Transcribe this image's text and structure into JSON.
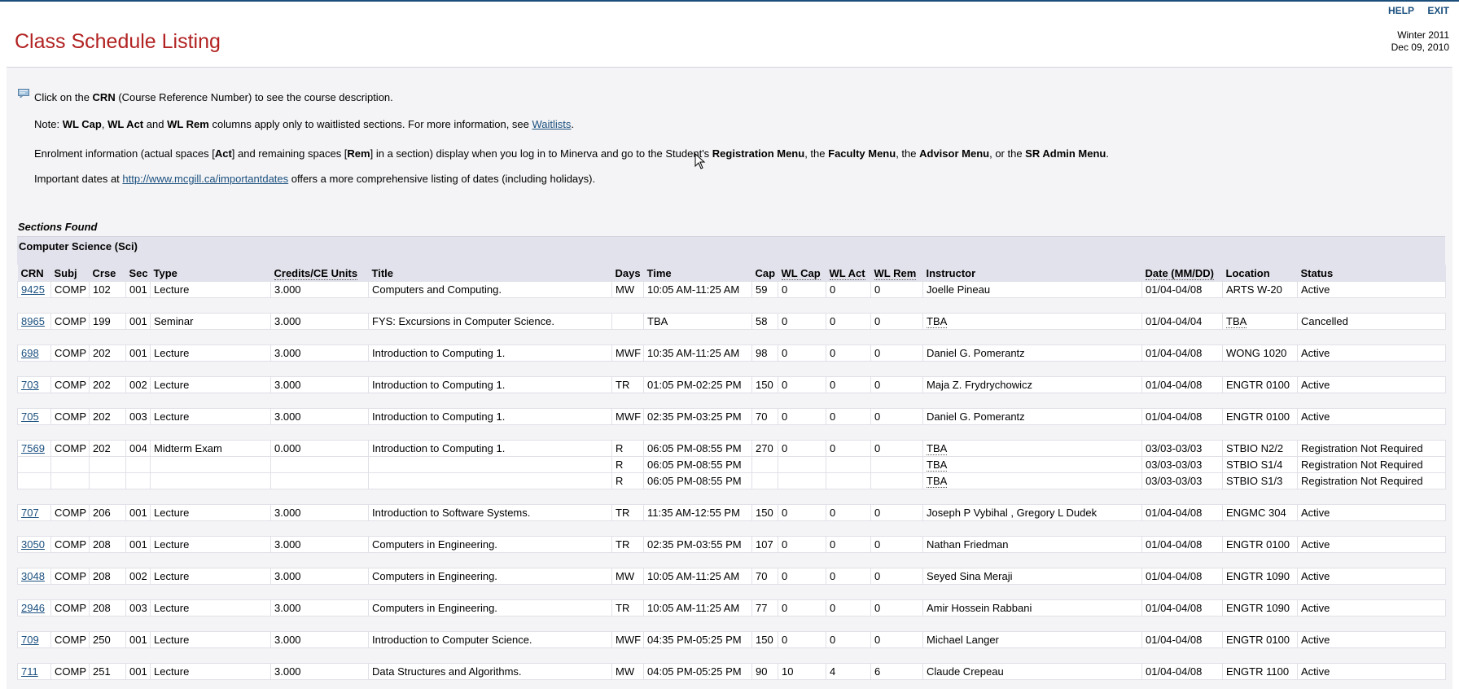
{
  "header": {
    "links": [
      "HELP",
      "EXIT"
    ],
    "title": "Class Schedule Listing",
    "term": "Winter 2011",
    "date": "Dec 09, 2010"
  },
  "notes": {
    "crn": {
      "pre": "Click on the ",
      "bold": "CRN",
      "post": " (Course Reference Number) to see the course description."
    },
    "waitlist": {
      "pre": "Note: ",
      "b1": "WL Cap",
      "m1": ", ",
      "b2": "WL Act",
      "m2": " and ",
      "b3": "WL Rem",
      "m3": " columns apply only to waitlisted sections. For more information, see ",
      "link": "Waitlists",
      "post": "."
    },
    "enrolment": {
      "t1": "Enrolment information (actual spaces [",
      "b1": "Act",
      "t2": "] and remaining spaces [",
      "b2": "Rem",
      "t3": "] in a section) display when you log in to Minerva and go to the Student's ",
      "b3": "Registration Menu",
      "t4": ", the ",
      "b4": "Faculty Menu",
      "t5": ", the ",
      "b5": "Advisor Menu",
      "t6": ", or the ",
      "b6": "SR Admin Menu",
      "t7": "."
    },
    "dates": {
      "pre": "Important dates at ",
      "link": "http://www.mcgill.ca/importantdates",
      "post": " offers a more comprehensive listing of dates (including holidays)."
    }
  },
  "sections_found": "Sections Found",
  "subject": "Computer Science (Sci)",
  "columns": [
    "CRN",
    "Subj",
    "Crse",
    "Sec",
    "Type",
    "Credits/CE Units",
    "Title",
    "Days",
    "Time",
    "Cap",
    "WL Cap",
    "WL Act",
    "WL Rem",
    "Instructor",
    "Date (MM/DD)",
    "Location",
    "Status"
  ],
  "rows": [
    {
      "crn": "9425",
      "subj": "COMP",
      "crse": "102",
      "sec": "001",
      "type": "Lecture",
      "credits": "3.000",
      "title": "Computers and Computing.",
      "days": "MW",
      "time": "10:05 AM-11:25 AM",
      "cap": "59",
      "wlcap": "0",
      "wlact": "0",
      "wlrem": "0",
      "instructor": "Joelle Pineau",
      "date": "01/04-04/08",
      "location": "ARTS W-20",
      "status": "Active"
    },
    {
      "crn": "8965",
      "subj": "COMP",
      "crse": "199",
      "sec": "001",
      "type": "Seminar",
      "credits": "3.000",
      "title": "FYS: Excursions in Computer Science.",
      "days": "",
      "time": "TBA",
      "cap": "58",
      "wlcap": "0",
      "wlact": "0",
      "wlrem": "0",
      "instructor": "TBA",
      "date": "01/04-04/04",
      "location": "TBA",
      "status": "Cancelled"
    },
    {
      "crn": "698",
      "subj": "COMP",
      "crse": "202",
      "sec": "001",
      "type": "Lecture",
      "credits": "3.000",
      "title": "Introduction to Computing 1.",
      "days": "MWF",
      "time": "10:35 AM-11:25 AM",
      "cap": "98",
      "wlcap": "0",
      "wlact": "0",
      "wlrem": "0",
      "instructor": "Daniel G. Pomerantz",
      "date": "01/04-04/08",
      "location": "WONG 1020",
      "status": "Active"
    },
    {
      "crn": "703",
      "subj": "COMP",
      "crse": "202",
      "sec": "002",
      "type": "Lecture",
      "credits": "3.000",
      "title": "Introduction to Computing 1.",
      "days": "TR",
      "time": "01:05 PM-02:25 PM",
      "cap": "150",
      "wlcap": "0",
      "wlact": "0",
      "wlrem": "0",
      "instructor": "Maja Z. Frydrychowicz",
      "date": "01/04-04/08",
      "location": "ENGTR 0100",
      "status": "Active"
    },
    {
      "crn": "705",
      "subj": "COMP",
      "crse": "202",
      "sec": "003",
      "type": "Lecture",
      "credits": "3.000",
      "title": "Introduction to Computing 1.",
      "days": "MWF",
      "time": "02:35 PM-03:25 PM",
      "cap": "70",
      "wlcap": "0",
      "wlact": "0",
      "wlrem": "0",
      "instructor": "Daniel G. Pomerantz",
      "date": "01/04-04/08",
      "location": "ENGTR 0100",
      "status": "Active"
    },
    {
      "crn": "7569",
      "subj": "COMP",
      "crse": "202",
      "sec": "004",
      "type": "Midterm Exam",
      "credits": "0.000",
      "title": "Introduction to Computing 1.",
      "days": "R",
      "time": "06:05 PM-08:55 PM",
      "cap": "270",
      "wlcap": "0",
      "wlact": "0",
      "wlrem": "0",
      "instructor": "TBA",
      "date": "03/03-03/03",
      "location": "STBIO N2/2",
      "status": "Registration Not Required",
      "extra": [
        {
          "days": "R",
          "time": "06:05 PM-08:55 PM",
          "instructor": "TBA",
          "date": "03/03-03/03",
          "location": "STBIO S1/4",
          "status": "Registration Not Required"
        },
        {
          "days": "R",
          "time": "06:05 PM-08:55 PM",
          "instructor": "TBA",
          "date": "03/03-03/03",
          "location": "STBIO S1/3",
          "status": "Registration Not Required"
        }
      ]
    },
    {
      "crn": "707",
      "subj": "COMP",
      "crse": "206",
      "sec": "001",
      "type": "Lecture",
      "credits": "3.000",
      "title": "Introduction to Software Systems.",
      "days": "TR",
      "time": "11:35 AM-12:55 PM",
      "cap": "150",
      "wlcap": "0",
      "wlact": "0",
      "wlrem": "0",
      "instructor": "Joseph P Vybihal , Gregory L Dudek",
      "date": "01/04-04/08",
      "location": "ENGMC 304",
      "status": "Active"
    },
    {
      "crn": "3050",
      "subj": "COMP",
      "crse": "208",
      "sec": "001",
      "type": "Lecture",
      "credits": "3.000",
      "title": "Computers in Engineering.",
      "days": "TR",
      "time": "02:35 PM-03:55 PM",
      "cap": "107",
      "wlcap": "0",
      "wlact": "0",
      "wlrem": "0",
      "instructor": "Nathan Friedman",
      "date": "01/04-04/08",
      "location": "ENGTR 0100",
      "status": "Active"
    },
    {
      "crn": "3048",
      "subj": "COMP",
      "crse": "208",
      "sec": "002",
      "type": "Lecture",
      "credits": "3.000",
      "title": "Computers in Engineering.",
      "days": "MW",
      "time": "10:05 AM-11:25 AM",
      "cap": "70",
      "wlcap": "0",
      "wlact": "0",
      "wlrem": "0",
      "instructor": "Seyed Sina Meraji",
      "date": "01/04-04/08",
      "location": "ENGTR 1090",
      "status": "Active"
    },
    {
      "crn": "2946",
      "subj": "COMP",
      "crse": "208",
      "sec": "003",
      "type": "Lecture",
      "credits": "3.000",
      "title": "Computers in Engineering.",
      "days": "TR",
      "time": "10:05 AM-11:25 AM",
      "cap": "77",
      "wlcap": "0",
      "wlact": "0",
      "wlrem": "0",
      "instructor": "Amir Hossein Rabbani",
      "date": "01/04-04/08",
      "location": "ENGTR 1090",
      "status": "Active"
    },
    {
      "crn": "709",
      "subj": "COMP",
      "crse": "250",
      "sec": "001",
      "type": "Lecture",
      "credits": "3.000",
      "title": "Introduction to Computer Science.",
      "days": "MWF",
      "time": "04:35 PM-05:25 PM",
      "cap": "150",
      "wlcap": "0",
      "wlact": "0",
      "wlrem": "0",
      "instructor": "Michael Langer",
      "date": "01/04-04/08",
      "location": "ENGTR 0100",
      "status": "Active"
    },
    {
      "crn": "711",
      "subj": "COMP",
      "crse": "251",
      "sec": "001",
      "type": "Lecture",
      "credits": "3.000",
      "title": "Data Structures and Algorithms.",
      "days": "MW",
      "time": "04:05 PM-05:25 PM",
      "cap": "90",
      "wlcap": "10",
      "wlact": "4",
      "wlrem": "6",
      "instructor": "Claude Crepeau",
      "date": "01/04-04/08",
      "location": "ENGTR 1100",
      "status": "Active"
    }
  ],
  "colors": {
    "title": "#b22222",
    "link": "#1a4f7e",
    "header_bg": "#e2e2ec",
    "panel_bg": "#f4f4f6"
  }
}
